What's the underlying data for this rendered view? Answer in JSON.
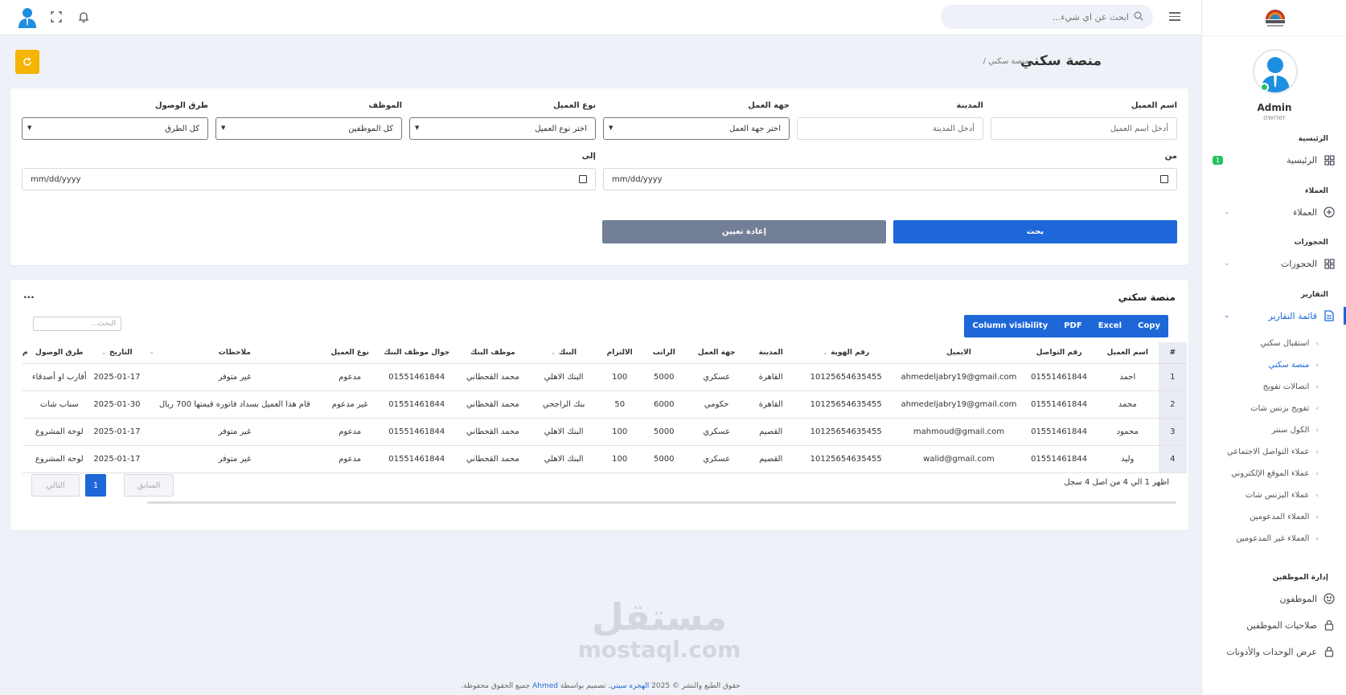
{
  "topbar": {
    "search_placeholder": "ابحث عن اي شيء..."
  },
  "sidebar": {
    "user_name": "Admin",
    "user_role": "owner",
    "sections": [
      {
        "title": "الرئيسية",
        "item": "الرئيسية",
        "badge": "1"
      },
      {
        "title": "العملاء",
        "item": "العملاء"
      },
      {
        "title": "الحجوزات",
        "item": "الحجوزات"
      },
      {
        "title": "التقارير",
        "item": "قائمة التقارير"
      }
    ],
    "report_items": [
      "استقبال سكني",
      "منصة سكني",
      "اتصالات تفويج",
      "تفويج بزنس شات",
      "الكول سنتر",
      "عملاء التواصل الاجتماعي",
      "عملاء الموقع الإلكتروني",
      "عملاء البزنس شات",
      "العملاء المدعومين",
      "العملاء غير المدعومين"
    ],
    "staff_section": "إدارة الموظفين",
    "staff_items": [
      "الموظفون",
      "صلاحيات الموظفين",
      "عرض الوحدات والأذونات"
    ]
  },
  "page": {
    "title": "منصة سكني",
    "breadcrumb": "/ منصة سكني"
  },
  "filters": {
    "client_name_label": "اسم العميل",
    "client_name_placeholder": "أدخل اسم العميل",
    "city_label": "المدينة",
    "city_placeholder": "أدخل المدينة",
    "employer_label": "جهة العمل",
    "employer_value": "اختر جهة العمل",
    "client_type_label": "نوع العميل",
    "client_type_value": "اختر نوع العميل",
    "employee_label": "الموظف",
    "employee_value": "كل الموظفين",
    "arrival_label": "طرق الوصول",
    "arrival_value": "كل الطرق",
    "from_label": "من",
    "to_label": "إلى",
    "date_placeholder": "mm/dd/yyyy",
    "search_button": "بحث",
    "reset_button": "إعادة تعيين"
  },
  "table": {
    "title": "منصة سكني",
    "more": "...",
    "export_buttons": [
      "Copy",
      "Excel",
      "PDF",
      "Column visibility"
    ],
    "search_placeholder": "البحث...",
    "headers": [
      "#",
      "اسم العميل",
      "رقم التواصل",
      "الايميل",
      "رقم الهوية",
      "المدينة",
      "جهة العمل",
      "الراتب",
      "الالتزام",
      "البنك",
      "موظف البنك",
      "جوال موظف البنك",
      "نوع العميل",
      "ملاحظات",
      "التاريخ",
      "طرق الوصول",
      "م"
    ],
    "rows": [
      [
        "1",
        "احمد",
        "01551461844",
        "ahmedeljabry19@gmail.com",
        "10125654635455",
        "القاهرة",
        "عسكري",
        "5000",
        "100",
        "البنك الاهلي",
        "محمد القحطاني",
        "01551461844",
        "مدعوم",
        "غير متوفر",
        "2025-01-17",
        "أقارب او أصدقاء"
      ],
      [
        "2",
        "محمد",
        "01551461844",
        "ahmedeljabry19@gmail.com",
        "10125654635455",
        "القاهرة",
        "حكومي",
        "6000",
        "50",
        "بنك الراجحي",
        "محمد القحطاني",
        "01551461844",
        "غير مدعوم",
        "قام هذا العميل بسداد فاتوره قيمتها 700 ريال",
        "2025-01-30",
        "سناب شات"
      ],
      [
        "3",
        "محمود",
        "01551461844",
        "mahmoud@gmail.com",
        "10125654635455",
        "القصيم",
        "عسكري",
        "5000",
        "100",
        "البنك الاهلي",
        "محمد القحطاني",
        "01551461844",
        "مدعوم",
        "غير متوفر",
        "2025-01-17",
        "لوحة المشروع"
      ],
      [
        "4",
        "وليد",
        "01551461844",
        "walid@gmail.com",
        "10125654635455",
        "القصيم",
        "عسكري",
        "5000",
        "100",
        "البنك الاهلي",
        "محمد القحطاني",
        "01551461844",
        "مدعوم",
        "غير متوفر",
        "2025-01-17",
        "لوحة المشروع"
      ]
    ],
    "info": "اظهر 1 الي 4 من اصل 4 سجل",
    "prev": "السابق",
    "page": "1",
    "next": "التالي"
  },
  "watermark": {
    "arabic": "مستقل",
    "latin": "mostaql.com"
  },
  "footer": {
    "text_before": "حقوق الطبع والنشر © 2025",
    "company": "الهجره سيتي",
    "text_mid": ". تصميم بواسطة",
    "author": "Ahmed",
    "text_after": "جميع الحقوق محفوظة."
  },
  "colors": {
    "primary": "#1d67d8",
    "secondary": "#737f97",
    "warning": "#f4b400",
    "success": "#22c55e"
  }
}
